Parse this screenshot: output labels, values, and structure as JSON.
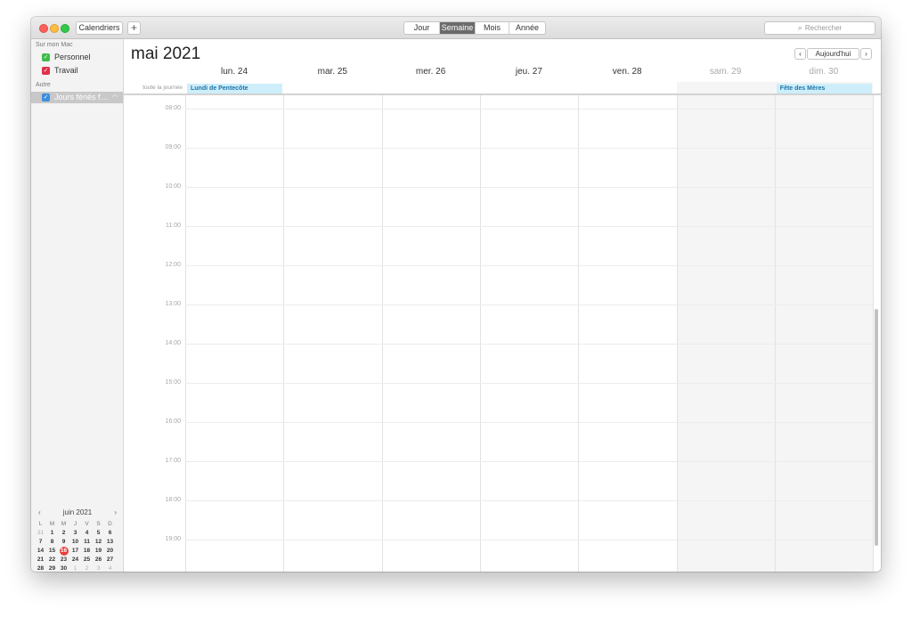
{
  "toolbar": {
    "calendars_label": "Calendriers",
    "add_label": "+",
    "views": [
      "Jour",
      "Semaine",
      "Mois",
      "Année"
    ],
    "active_view": "Semaine",
    "search_placeholder": "Rechercher"
  },
  "sidebar": {
    "sections": [
      {
        "title": "Sur mon Mac",
        "items": [
          {
            "label": "Personnel",
            "color": "#3dbd4a",
            "checked": true
          },
          {
            "label": "Travail",
            "color": "#e0304b",
            "checked": true
          }
        ]
      },
      {
        "title": "Autre",
        "items": [
          {
            "label": "Jours fériés f…",
            "color": "#3b8fe0",
            "checked": true,
            "selected": true
          }
        ]
      }
    ]
  },
  "mini_calendar": {
    "month": "juin 2021",
    "weekdays": [
      "L",
      "M",
      "M",
      "J",
      "V",
      "S",
      "D"
    ],
    "weeks": [
      [
        "31",
        "1",
        "2",
        "3",
        "4",
        "5",
        "6"
      ],
      [
        "7",
        "8",
        "9",
        "10",
        "11",
        "12",
        "13"
      ],
      [
        "14",
        "15",
        "16",
        "17",
        "18",
        "19",
        "20"
      ],
      [
        "21",
        "22",
        "23",
        "24",
        "25",
        "26",
        "27"
      ],
      [
        "28",
        "29",
        "30",
        "1",
        "2",
        "3",
        "4"
      ],
      [
        "5",
        "6",
        "7",
        "8",
        "9",
        "10",
        "11"
      ]
    ],
    "today": "16"
  },
  "main": {
    "title": "mai 2021",
    "today_label": "Aujourd'hui",
    "allday_label": "toute la journée",
    "days": [
      {
        "label": "lun. 24",
        "weekend": false
      },
      {
        "label": "mar. 25",
        "weekend": false
      },
      {
        "label": "mer. 26",
        "weekend": false
      },
      {
        "label": "jeu. 27",
        "weekend": false
      },
      {
        "label": "ven. 28",
        "weekend": false
      },
      {
        "label": "sam. 29",
        "weekend": true
      },
      {
        "label": "dim. 30",
        "weekend": true
      }
    ],
    "allday_events": [
      {
        "day": 0,
        "label": "Lundi de Pentecôte"
      },
      {
        "day": 6,
        "label": "Fête des Mères"
      }
    ],
    "hours": [
      "08:00",
      "09:00",
      "10:00",
      "11:00",
      "12:00",
      "13:00",
      "14:00",
      "15:00",
      "16:00",
      "17:00",
      "18:00",
      "19:00"
    ]
  }
}
